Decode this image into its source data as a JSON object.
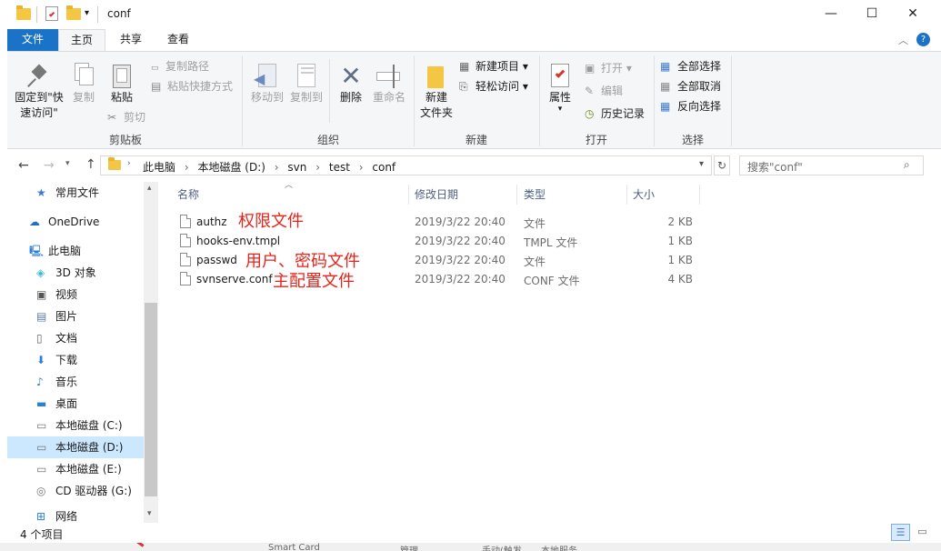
{
  "window": {
    "title": "conf",
    "min": "—",
    "max": "☐",
    "close": "✕"
  },
  "tabs": {
    "file": "文件",
    "home": "主页",
    "share": "共享",
    "view": "查看"
  },
  "ribbon": {
    "clipboard": {
      "pin": "固定到\"快",
      "pin2": "速访问\"",
      "copy": "复制",
      "paste": "粘贴",
      "copy_path": "复制路径",
      "paste_shortcut": "粘贴快捷方式",
      "cut": "剪切",
      "label": "剪贴板"
    },
    "organize": {
      "move": "移动到",
      "copyto": "复制到",
      "delete": "删除",
      "rename": "重命名",
      "label": "组织"
    },
    "new": {
      "new_folder1": "新建",
      "new_folder2": "文件夹",
      "new_item": "新建项目",
      "easy_access": "轻松访问",
      "label": "新建"
    },
    "open": {
      "properties": "属性",
      "open": "打开",
      "edit": "编辑",
      "history": "历史记录",
      "label": "打开"
    },
    "select": {
      "all": "全部选择",
      "none": "全部取消",
      "invert": "反向选择",
      "label": "选择"
    }
  },
  "address": {
    "crumbs": [
      "此电脑",
      "本地磁盘 (D:)",
      "svn",
      "test",
      "conf"
    ],
    "search_placeholder": "搜索\"conf\""
  },
  "nav": [
    "常用文件",
    "OneDrive",
    "此电脑",
    "3D 对象",
    "视频",
    "图片",
    "文档",
    "下载",
    "音乐",
    "桌面",
    "本地磁盘 (C:)",
    "本地磁盘 (D:)",
    "本地磁盘 (E:)",
    "CD 驱动器 (G:)",
    "网络"
  ],
  "columns": {
    "name": "名称",
    "date": "修改日期",
    "type": "类型",
    "size": "大小"
  },
  "files": [
    {
      "name": "authz",
      "date": "2019/3/22 20:40",
      "type": "文件",
      "size": "2 KB"
    },
    {
      "name": "hooks-env.tmpl",
      "date": "2019/3/22 20:40",
      "type": "TMPL 文件",
      "size": "1 KB"
    },
    {
      "name": "passwd",
      "date": "2019/3/22 20:40",
      "type": "文件",
      "size": "1 KB"
    },
    {
      "name": "svnserve.conf",
      "date": "2019/3/22 20:40",
      "type": "CONF 文件",
      "size": "4 KB"
    }
  ],
  "annotations": {
    "authz": "权限文件",
    "passwd": "用户、密码文件",
    "svnserve": "主配置文件"
  },
  "status": {
    "count": "4 个项目"
  },
  "taskbar": {
    "a": "Smart Card",
    "b": "管理",
    "c": "手动(触发...",
    "d": "本地服务"
  },
  "colors": {
    "accent": "#1a73c6",
    "annotation": "#e8231a",
    "selected": "#cce8ff"
  }
}
